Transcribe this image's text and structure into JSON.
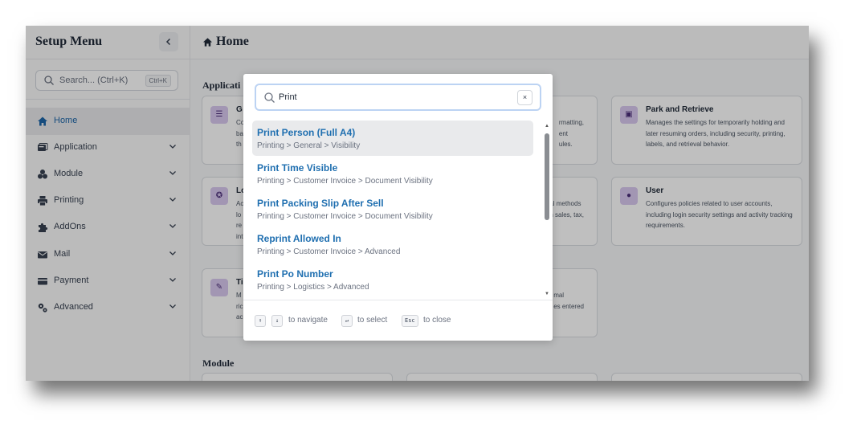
{
  "sidebar": {
    "title": "Setup Menu",
    "collapse_icon": "chevron-left-icon",
    "search_placeholder": "Search... (Ctrl+K)",
    "search_shortcut": "Ctrl+K",
    "items": [
      {
        "label": "Home",
        "icon": "home-icon",
        "active": true
      },
      {
        "label": "Application",
        "icon": "application-icon"
      },
      {
        "label": "Module",
        "icon": "module-icon"
      },
      {
        "label": "Printing",
        "icon": "printer-icon"
      },
      {
        "label": "AddOns",
        "icon": "puzzle-icon"
      },
      {
        "label": "Mail",
        "icon": "mail-icon"
      },
      {
        "label": "Payment",
        "icon": "payment-icon"
      },
      {
        "label": "Advanced",
        "icon": "cogs-icon"
      }
    ]
  },
  "main": {
    "title": "Home",
    "section_application": "Applicati",
    "section_module": "Module",
    "cards": {
      "c1": {
        "title": "G",
        "desc_left": "Co\nba\nth",
        "desc_right": "rmatting,\nent\nules."
      },
      "park": {
        "title": "Park and Retrieve",
        "desc": "Manages the settings for temporarily holding and later resuming orders, including security, printing, labels, and retrieval behavior."
      },
      "c2": {
        "title": "Lo",
        "desc_left": "Ac\nlo\nre\nint",
        "desc_right": "al methods\nn sales, tax,"
      },
      "user": {
        "title": "User",
        "desc": "Configures policies related to user accounts, including login security settings and activity tracking requirements."
      },
      "c3": {
        "title": "Ti",
        "desc_left": "M\nric\nac",
        "desc_right": "mal\nes entered"
      }
    }
  },
  "modal": {
    "search_value": "Print",
    "clear_label": "×",
    "results": [
      {
        "title": "Print Person (Full A4)",
        "path": "Printing > General > Visibility"
      },
      {
        "title": "Print Time Visible",
        "path": "Printing > Customer Invoice > Document Visibility"
      },
      {
        "title": "Print Packing Slip After Sell",
        "path": "Printing > Customer Invoice > Document Visibility"
      },
      {
        "title": "Reprint Allowed In",
        "path": "Printing > Customer Invoice > Advanced"
      },
      {
        "title": "Print Po Number",
        "path": "Printing > Logistics > Advanced"
      }
    ],
    "footer": {
      "up_key": "↑",
      "down_key": "↓",
      "navigate_text": "to navigate",
      "enter_key": "↵",
      "select_text": "to select",
      "esc_key": "Esc",
      "close_text": "to close"
    }
  }
}
